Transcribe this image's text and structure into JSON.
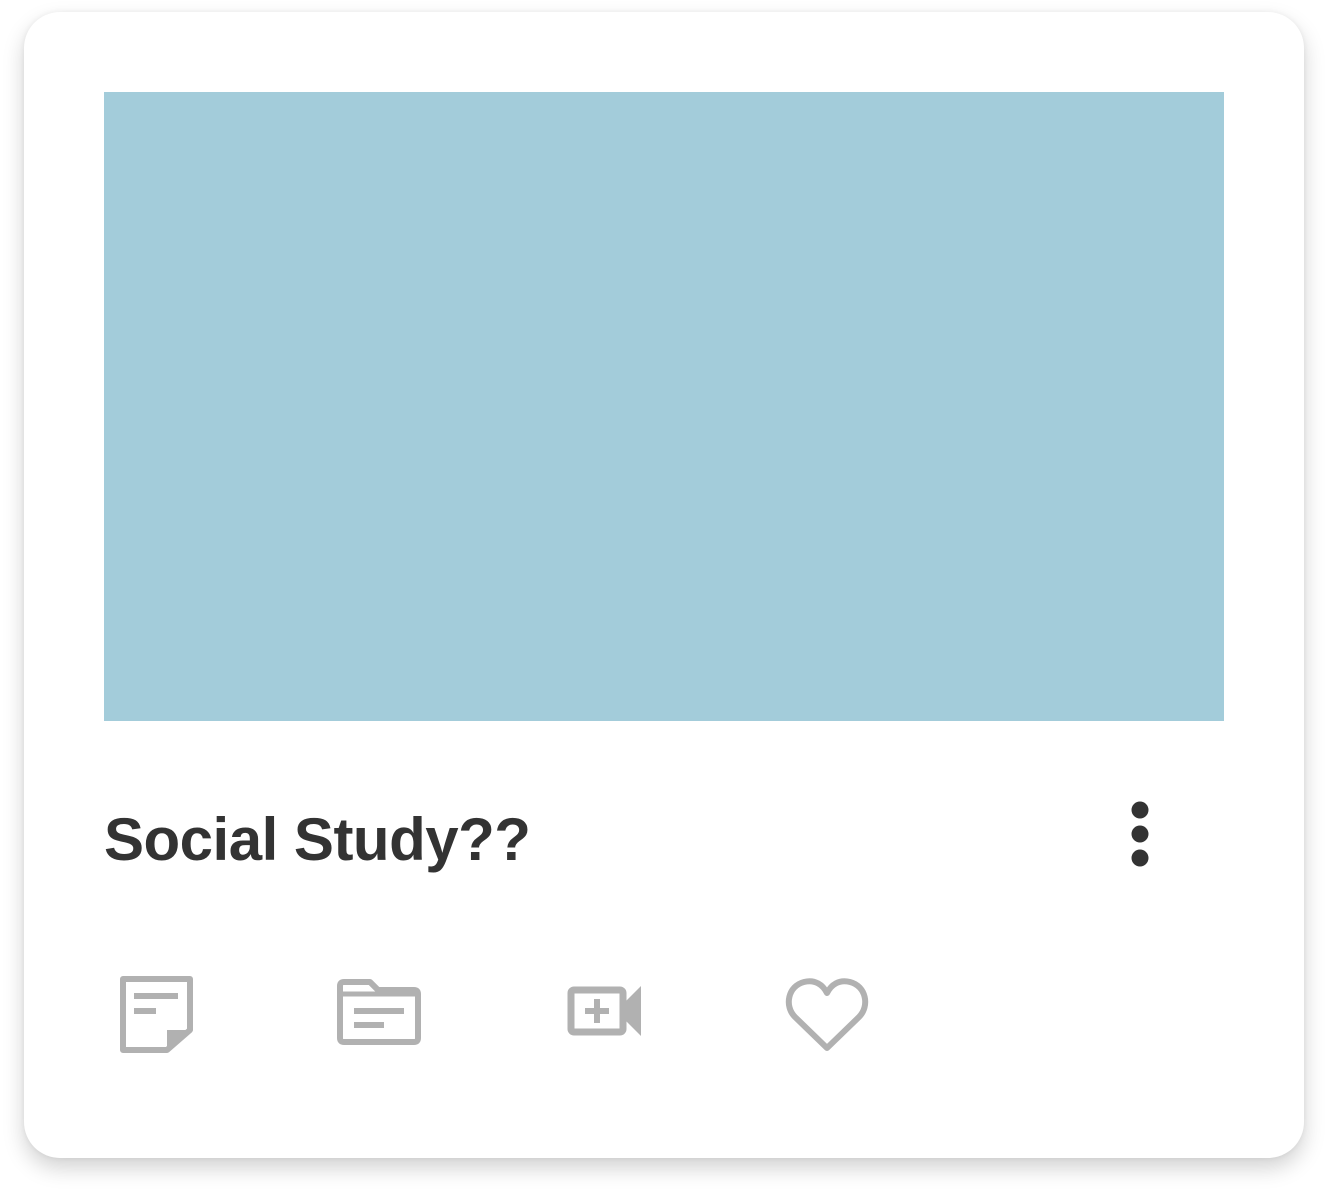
{
  "card": {
    "title": "Social Study??",
    "thumbnail_color": "#a3ccda"
  },
  "actions": [
    {
      "name": "notes",
      "icon": "note-icon"
    },
    {
      "name": "files",
      "icon": "folder-icon"
    },
    {
      "name": "video",
      "icon": "video-add-icon"
    },
    {
      "name": "favorite",
      "icon": "heart-outline-icon"
    }
  ],
  "menu": {
    "icon": "more-vertical-icon"
  },
  "colors": {
    "title": "#333333",
    "icon": "#b1b1b1",
    "menu_dots": "#333333",
    "card_bg": "#ffffff"
  }
}
